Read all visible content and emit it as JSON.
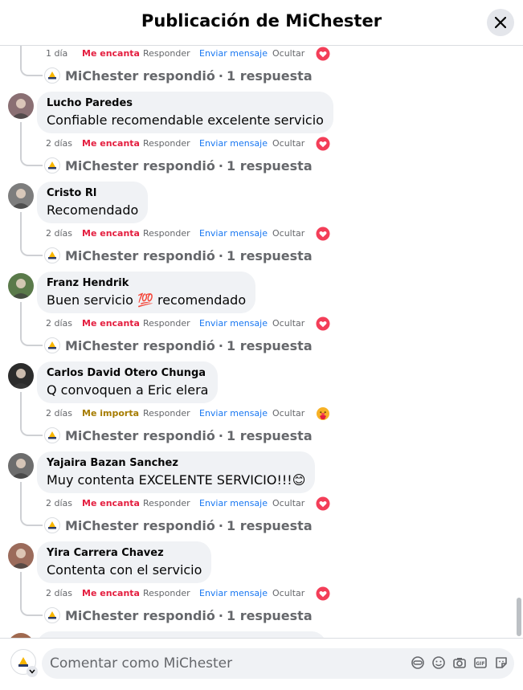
{
  "header": {
    "title": "Publicación de MiChester"
  },
  "actions_labels": {
    "reply": "Responder",
    "message": "Enviar mensaje",
    "hide": "Ocultar"
  },
  "reply_summary": {
    "author": "MiChester respondió",
    "separator": "·",
    "count": "1 respuesta"
  },
  "comments": [
    {
      "name": "",
      "text": "",
      "time": "1 día",
      "reaction": "Me encanta",
      "reaction_icon": "heart-icon"
    },
    {
      "name": "Lucho Paredes",
      "text": "Confiable recomendable excelente servicio",
      "time": "2 días",
      "reaction": "Me encanta",
      "reaction_icon": "heart-icon"
    },
    {
      "name": "Cristo Rl",
      "text": "Recomendado",
      "time": "2 días",
      "reaction": "Me encanta",
      "reaction_icon": "heart-icon"
    },
    {
      "name": "Franz Hendrik",
      "text": "Buen servicio 💯 recomendado",
      "time": "2 días",
      "reaction": "Me encanta",
      "reaction_icon": "heart-icon"
    },
    {
      "name": "Carlos David Otero Chunga",
      "text": "Q convoquen a Eric elera",
      "time": "2 días",
      "reaction": "Me importa",
      "reaction_icon": "care-icon"
    },
    {
      "name": "Yajaira Bazan Sanchez",
      "text": "Muy contenta EXCELENTE SERVICIO!!!😊",
      "time": "2 días",
      "reaction": "Me encanta",
      "reaction_icon": "heart-icon"
    },
    {
      "name": "Yira Carrera Chavez",
      "text": "Contenta con el servicio",
      "time": "2 días",
      "reaction": "Me encanta",
      "reaction_icon": "heart-icon"
    }
  ],
  "footer": {
    "placeholder": "Comentar como MiChester",
    "tools": [
      "avatar-sticker-icon",
      "emoji-icon",
      "camera-icon",
      "gif-icon",
      "sticker-icon"
    ]
  },
  "colors": {
    "love": "#e41e3f",
    "care": "#a67c00",
    "link": "#1877f2",
    "muted": "#65676b",
    "bubble": "#f0f2f5"
  }
}
